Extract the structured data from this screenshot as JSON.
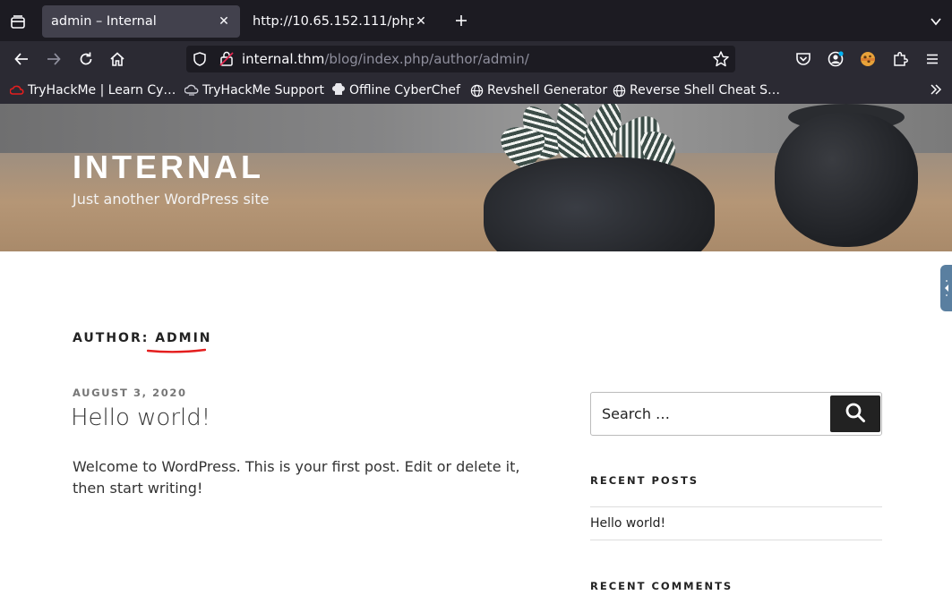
{
  "browser": {
    "tabs": [
      {
        "title": "admin – Internal",
        "active": true
      },
      {
        "title": "http://10.65.152.111/phpmy",
        "active": false
      }
    ],
    "url": {
      "host": "internal.thm",
      "path": "/blog/index.php/author/admin/"
    },
    "bookmarks": [
      {
        "label": "TryHackMe | Learn Cy…",
        "icon": "tryhackme-icon"
      },
      {
        "label": "TryHackMe Support",
        "icon": "cloud-icon"
      },
      {
        "label": "Offline CyberChef",
        "icon": "chef-hat-icon"
      },
      {
        "label": "Revshell Generator",
        "icon": "globe-icon"
      },
      {
        "label": "Reverse Shell Cheat S…",
        "icon": "globe-icon"
      }
    ],
    "accent_color": "#e41e1e"
  },
  "site": {
    "title": "INTERNAL",
    "description": "Just another WordPress site"
  },
  "archive": {
    "prefix": "AUTHOR: ",
    "author": "ADMIN"
  },
  "post": {
    "date": "AUGUST 3, 2020",
    "title": "Hello world!",
    "excerpt": "Welcome to WordPress. This is your first post. Edit or delete it, then start writing!"
  },
  "sidebar": {
    "search_placeholder": "Search …",
    "recent_posts_title": "RECENT POSTS",
    "recent_posts": [
      "Hello world!"
    ],
    "recent_comments_title": "RECENT COMMENTS"
  }
}
